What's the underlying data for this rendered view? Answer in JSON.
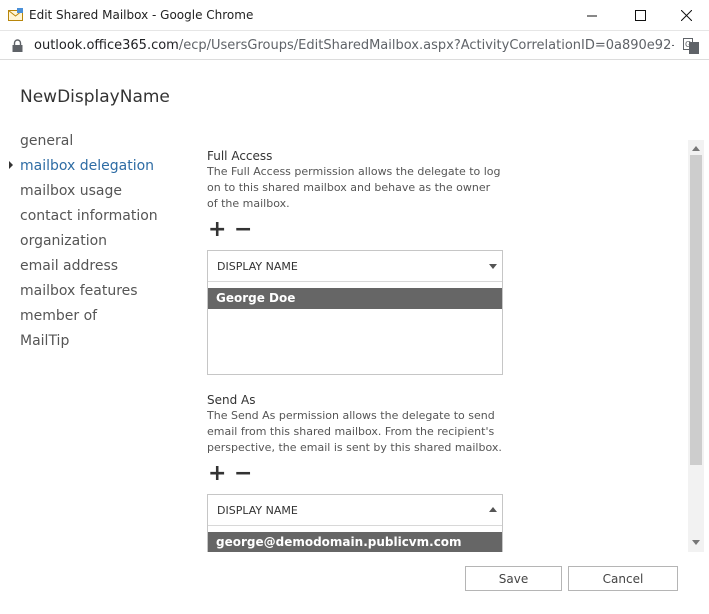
{
  "window": {
    "title": "Edit Shared Mailbox - Google Chrome",
    "minimize_glyph": "—",
    "maximize_glyph": "☐",
    "close_glyph": "✕"
  },
  "address_bar": {
    "host": "outlook.office365.com",
    "path": "/ecp/UsersGroups/EditSharedMailbox.aspx?ActivityCorrelationID=0a890e92-ca..."
  },
  "page": {
    "title": "NewDisplayName"
  },
  "nav": {
    "items": [
      {
        "label": "general"
      },
      {
        "label": "mailbox delegation"
      },
      {
        "label": "mailbox usage"
      },
      {
        "label": "contact information"
      },
      {
        "label": "organization"
      },
      {
        "label": "email address"
      },
      {
        "label": "mailbox features"
      },
      {
        "label": "member of"
      },
      {
        "label": "MailTip"
      }
    ],
    "active_index": 1
  },
  "full_access": {
    "title": "Full Access",
    "description": "The Full Access permission allows the delegate to log on to this shared mailbox and behave as the owner of the mailbox.",
    "add_glyph": "+",
    "remove_glyph": "−",
    "column_header": "DISPLAY NAME",
    "rows": [
      "George Doe"
    ]
  },
  "send_as": {
    "title": "Send As",
    "description": "The Send As permission allows the delegate to send email from this shared mailbox. From the recipient's perspective, the email is sent by this shared mailbox.",
    "add_glyph": "+",
    "remove_glyph": "−",
    "column_header": "DISPLAY NAME",
    "rows": [
      "george@demodomain.publicvm.com"
    ]
  },
  "footer": {
    "save_label": "Save",
    "cancel_label": "Cancel"
  },
  "colors": {
    "accent": "#2e6ca4",
    "selected_row": "#666666"
  }
}
